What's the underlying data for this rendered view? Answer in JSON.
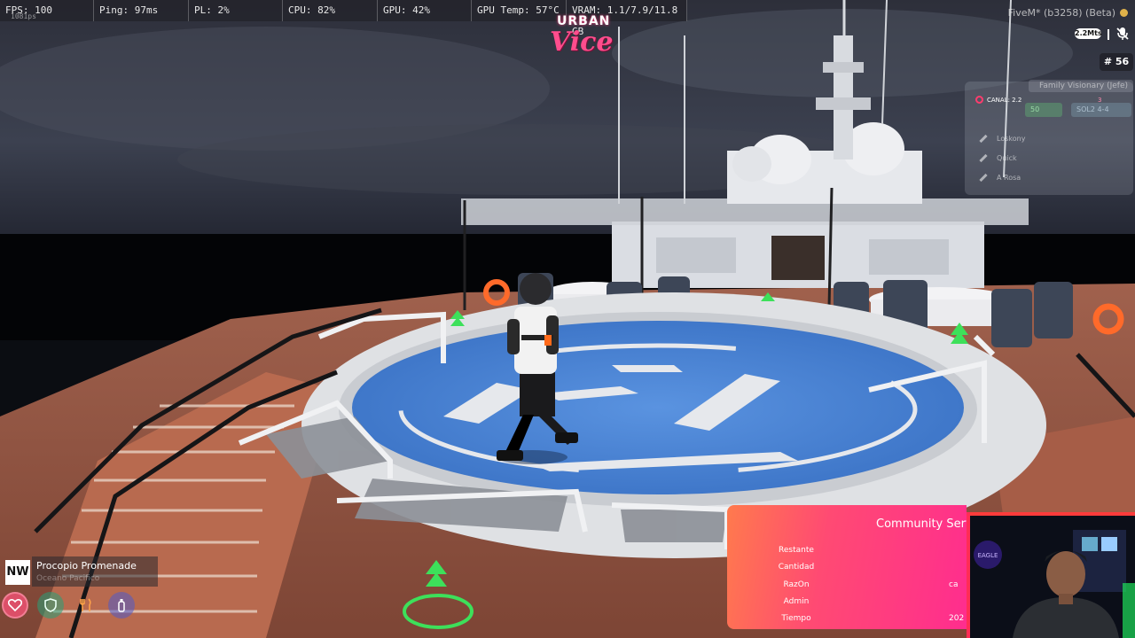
{
  "stats": [
    {
      "label": "FPS: 100",
      "width": 106
    },
    {
      "label": "Ping: 97ms",
      "width": 107
    },
    {
      "label": "PL: 2%",
      "width": 106
    },
    {
      "label": "CPU: 82%",
      "width": 107
    },
    {
      "label": "GPU: 42%",
      "width": 106
    },
    {
      "label": "GPU Temp: 57°C",
      "width": 107
    },
    {
      "label": "VRAM: 1.1/7.9/11.8 GB",
      "width": 136
    }
  ],
  "resolution": "1081ps",
  "logo": {
    "top": "URBAN",
    "main": "Vice"
  },
  "client": {
    "title": "FiveM* (b3258) (Beta)",
    "status_color": "#e0b24a"
  },
  "voice": {
    "range": "2.2Mts",
    "mic_state": "muted"
  },
  "player_id": "# 56",
  "radio": {
    "family": "Family Visionary (Jefe)",
    "channel": "CANAL: 2.2",
    "chip_count": "50",
    "chip_label": "SOL2 4-4",
    "pink_count": "3",
    "members": [
      "Loskony",
      "Quick",
      "A Rosa"
    ]
  },
  "location": {
    "box": "NW",
    "street": "Procopio Promenade",
    "area": "Oceano Pacifico"
  },
  "hud_icons": [
    "heart-icon",
    "shield-icon",
    "food-icon",
    "water-bottle-icon"
  ],
  "community_service": {
    "title": "Community Service",
    "rows": [
      {
        "label": "Restante",
        "value": ""
      },
      {
        "label": "Cantidad",
        "value": ""
      },
      {
        "label": "RazOn",
        "value": "ca"
      },
      {
        "label": "Admin",
        "value": ""
      },
      {
        "label": "Tiempo",
        "value": "202"
      }
    ]
  },
  "webcam": {
    "sign": "EAGLE"
  },
  "colors": {
    "accent_pink": "#ff2d8e",
    "helipad_blue": "#4a86d9",
    "deck_wood": "#b5654a"
  }
}
